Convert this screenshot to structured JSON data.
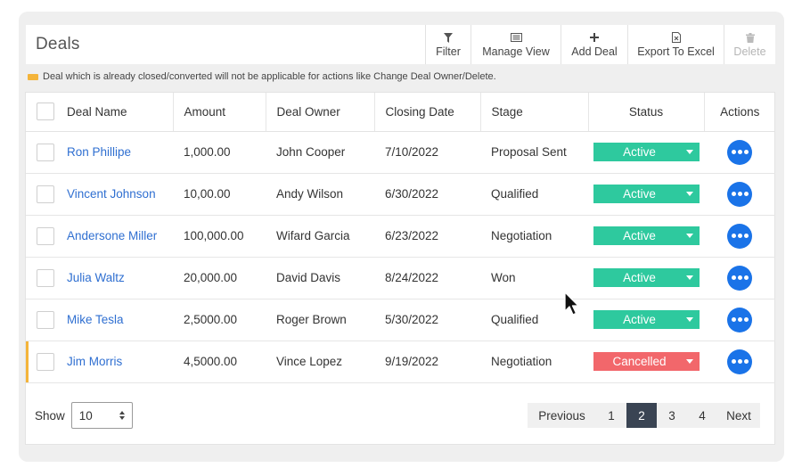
{
  "header": {
    "title": "Deals"
  },
  "toolbar": [
    {
      "label": "Filter",
      "icon": "filter-icon",
      "disabled": false
    },
    {
      "label": "Manage View",
      "icon": "list-view-icon",
      "disabled": false
    },
    {
      "label": "Add Deal",
      "icon": "plus-icon",
      "disabled": false
    },
    {
      "label": "Export To Excel",
      "icon": "excel-file-icon",
      "disabled": false
    },
    {
      "label": "Delete",
      "icon": "trash-icon",
      "disabled": true
    }
  ],
  "notice": {
    "text": "Deal which is already closed/converted will not be applicable for actions like Change Deal Owner/Delete.",
    "color": "#f4b43a"
  },
  "table": {
    "columns": [
      "Deal Name",
      "Amount",
      "Deal Owner",
      "Closing Date",
      "Stage",
      "Status",
      "Actions"
    ],
    "rows": [
      {
        "name": "Ron Phillipe",
        "amount": "1,000.00",
        "owner": "John Cooper",
        "date": "7/10/2022",
        "stage": "Proposal Sent",
        "status": "Active",
        "flagged": false
      },
      {
        "name": "Vincent Johnson",
        "amount": "10,00.00",
        "owner": "Andy Wilson",
        "date": "6/30/2022",
        "stage": "Qualified",
        "status": "Active",
        "flagged": false
      },
      {
        "name": "Andersone Miller",
        "amount": "100,000.00",
        "owner": "Wifard Garcia",
        "date": "6/23/2022",
        "stage": "Negotiation",
        "status": "Active",
        "flagged": false
      },
      {
        "name": "Julia Waltz",
        "amount": "20,000.00",
        "owner": "David Davis",
        "date": "8/24/2022",
        "stage": "Won",
        "status": "Active",
        "flagged": false
      },
      {
        "name": "Mike Tesla",
        "amount": "2,5000.00",
        "owner": "Roger Brown",
        "date": "5/30/2022",
        "stage": "Qualified",
        "status": "Active",
        "flagged": false
      },
      {
        "name": "Jim Morris",
        "amount": "4,5000.00",
        "owner": "Vince Lopez",
        "date": "9/19/2022",
        "stage": "Negotiation",
        "status": "Cancelled",
        "flagged": true
      }
    ]
  },
  "status_colors": {
    "Active": "#2ec99e",
    "Cancelled": "#f2676b"
  },
  "footer": {
    "show_label": "Show",
    "page_size": "10",
    "pagination": {
      "previous": "Previous",
      "next": "Next",
      "pages": [
        "1",
        "2",
        "3",
        "4"
      ],
      "current": "2"
    }
  }
}
